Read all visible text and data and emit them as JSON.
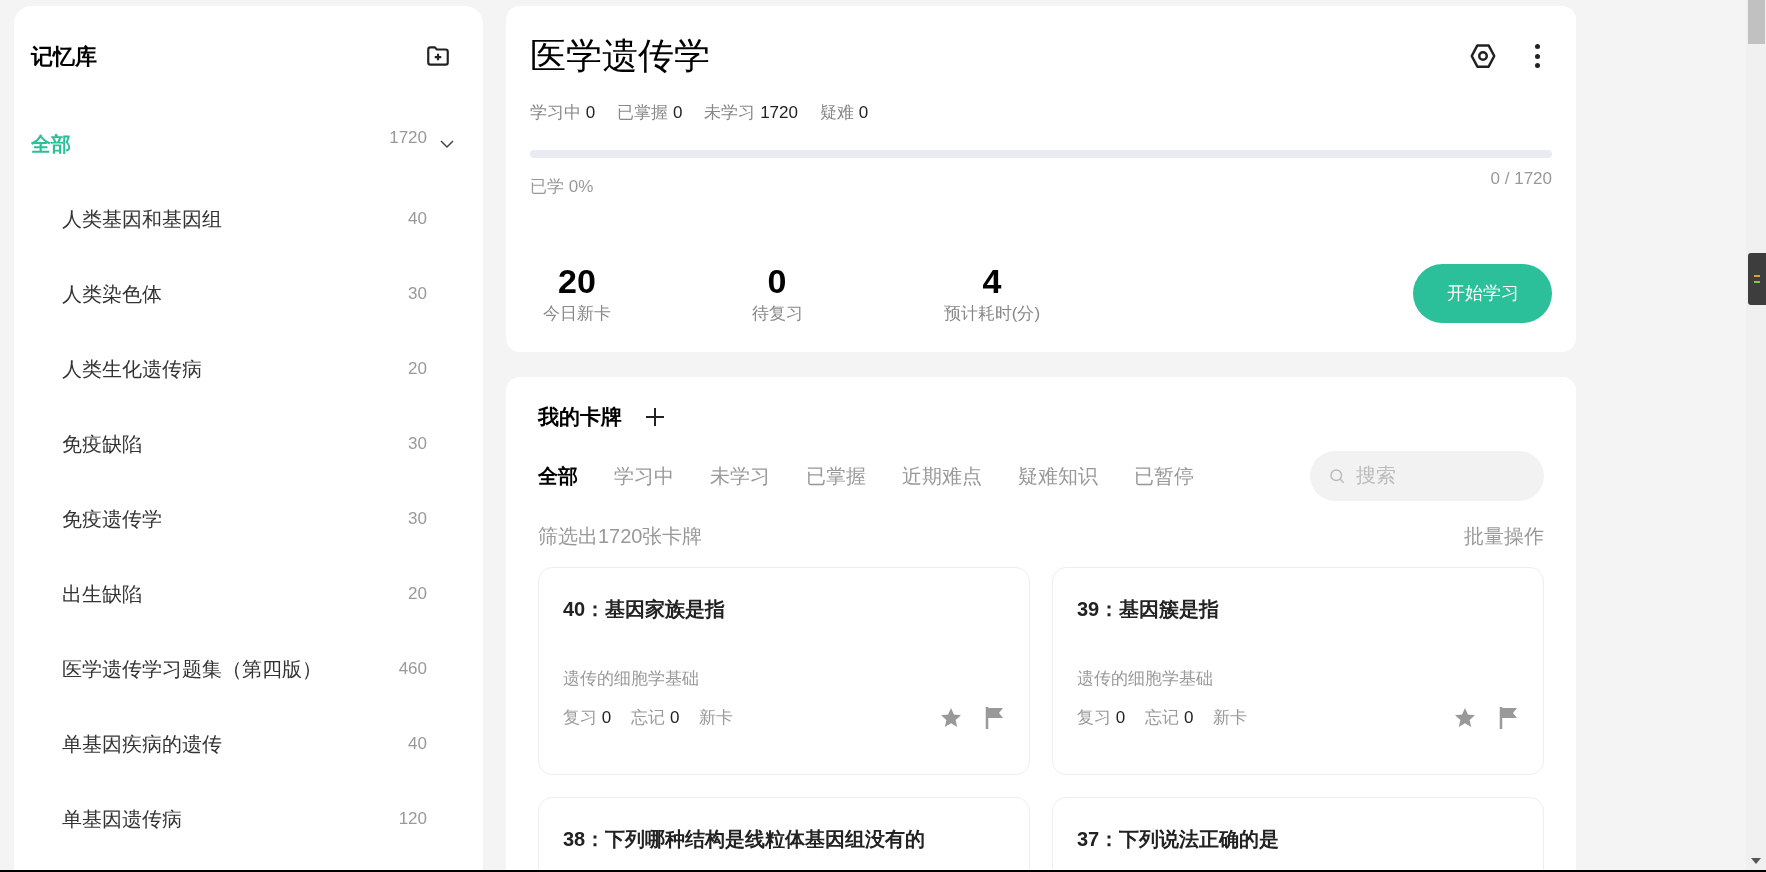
{
  "sidebar": {
    "title": "记忆库",
    "items": [
      {
        "label": "全部",
        "count": "1720",
        "selected": true,
        "expanded": true,
        "children": [
          {
            "label": "人类基因和基因组",
            "count": "40",
            "selected": false
          },
          {
            "label": "人类染色体",
            "count": "30",
            "selected": false
          },
          {
            "label": "人类生化遗传病",
            "count": "20",
            "selected": false
          },
          {
            "label": "免疫缺陷",
            "count": "30",
            "selected": false
          },
          {
            "label": "免疫遗传学",
            "count": "30",
            "selected": false
          },
          {
            "label": "出生缺陷",
            "count": "20",
            "selected": false
          },
          {
            "label": "医学遗传学习题集（第四版）",
            "count": "460",
            "selected": false
          },
          {
            "label": "单基因疾病的遗传",
            "count": "40",
            "selected": false
          },
          {
            "label": "单基因遗传病",
            "count": "120",
            "selected": false
          }
        ]
      }
    ]
  },
  "deck": {
    "title": "医学遗传学",
    "stats": [
      {
        "label": "学习中",
        "value": "0"
      },
      {
        "label": "已掌握",
        "value": "0"
      },
      {
        "label": "未学习",
        "value": "1720"
      },
      {
        "label": "疑难",
        "value": "0"
      }
    ],
    "progress": {
      "level": 0,
      "label": "已学 0%",
      "count": "0 / 1720"
    },
    "summary": [
      {
        "value": "20",
        "label": "今日新卡"
      },
      {
        "value": "0",
        "label": "待复习"
      },
      {
        "value": "4",
        "label": "预计耗时(分)"
      }
    ],
    "start_button": "开始学习"
  },
  "cards": {
    "title": "我的卡牌",
    "tabs": [
      {
        "label": "全部",
        "selected": true
      },
      {
        "label": "学习中",
        "selected": false
      },
      {
        "label": "未学习",
        "selected": false
      },
      {
        "label": "已掌握",
        "selected": false
      },
      {
        "label": "近期难点",
        "selected": false
      },
      {
        "label": "疑难知识",
        "selected": false
      },
      {
        "label": "已暂停",
        "selected": false
      }
    ],
    "search": {
      "placeholder": "搜索"
    },
    "filter_text": "筛选出1720张卡牌",
    "batch_action": "批量操作",
    "items": [
      {
        "title": "40：基因家族是指",
        "category": "遗传的细胞学基础",
        "review_label": "复习",
        "review": "0",
        "forget_label": "忘记",
        "forget": "0",
        "tag": "新卡"
      },
      {
        "title": "39：基因簇是指",
        "category": "遗传的细胞学基础",
        "review_label": "复习",
        "review": "0",
        "forget_label": "忘记",
        "forget": "0",
        "tag": "新卡"
      },
      {
        "title": "38：下列哪种结构是线粒体基因组没有的"
      },
      {
        "title": "37：下列说法正确的是"
      }
    ]
  }
}
